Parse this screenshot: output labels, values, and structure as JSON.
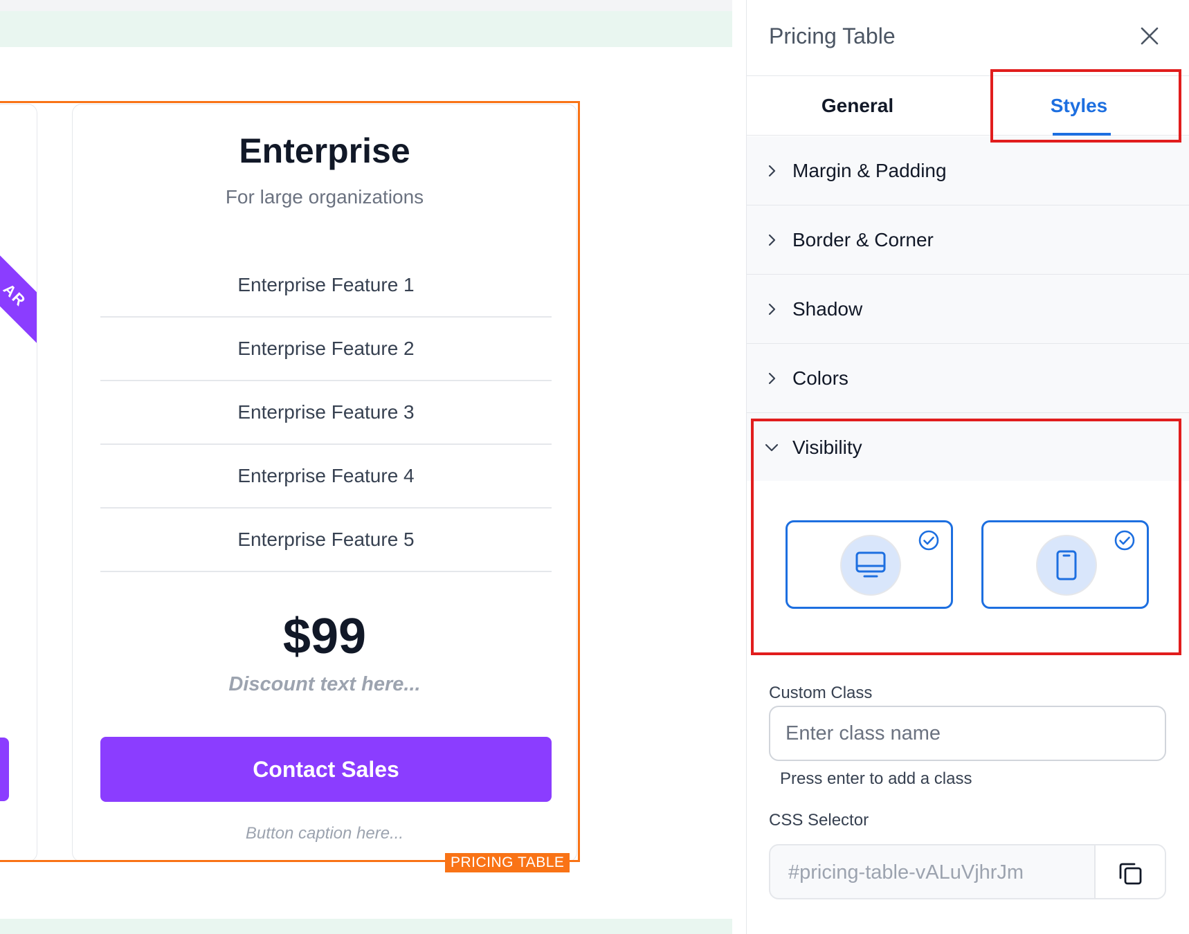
{
  "canvas": {
    "left_card": {
      "ribbon_text": "AR"
    },
    "card": {
      "name": "Enterprise",
      "subtitle": "For large organizations",
      "features": [
        "Enterprise Feature 1",
        "Enterprise Feature 2",
        "Enterprise Feature 3",
        "Enterprise Feature 4",
        "Enterprise Feature 5"
      ],
      "price": "$99",
      "discount": "Discount text here...",
      "cta_label": "Contact Sales",
      "caption": "Button caption here..."
    },
    "selection_tag": "PRICING TABLE"
  },
  "panel": {
    "title": "Pricing Table",
    "close_icon": "close-icon",
    "tabs": [
      {
        "label": "General",
        "active": false
      },
      {
        "label": "Styles",
        "active": true
      }
    ],
    "sections": [
      {
        "label": "Margin & Padding",
        "expanded": false
      },
      {
        "label": "Border & Corner",
        "expanded": false
      },
      {
        "label": "Shadow",
        "expanded": false
      },
      {
        "label": "Colors",
        "expanded": false
      },
      {
        "label": "Visibility",
        "expanded": true
      }
    ],
    "visibility": {
      "devices": [
        {
          "icon": "desktop-icon",
          "checked": true
        },
        {
          "icon": "mobile-icon",
          "checked": true
        }
      ]
    },
    "custom_class": {
      "label": "Custom Class",
      "placeholder": "Enter class name",
      "value": "",
      "hint": "Press enter to add a class"
    },
    "css_selector": {
      "label": "CSS Selector",
      "value": "#pricing-table-vALuVjhrJm",
      "copy_icon": "copy-icon"
    }
  },
  "colors": {
    "accent_blue": "#1d6fe0",
    "cta_purple": "#8b3dff",
    "selection_orange": "#f97316",
    "highlight_red": "#e11d1d",
    "canvas_strip": "#e9f6f0"
  }
}
